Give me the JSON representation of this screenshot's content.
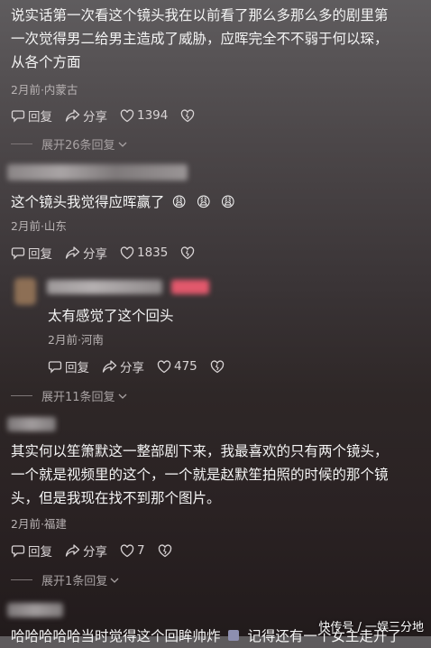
{
  "comments": [
    {
      "text_lines": [
        "说实话第一次看这个镜头我在以前看了那么多那么多的剧里第",
        "一次觉得男二给男主造成了威胁，应晖完全不不弱于何以琛，",
        "从各个方面"
      ],
      "meta": "2月前·内蒙古",
      "reply_label": "回复",
      "share_label": "分享",
      "likes": "1394",
      "expand_label": "展开26条回复"
    },
    {
      "text_lines": [
        "这个镜头我觉得应晖赢了"
      ],
      "emoji": [
        "😩",
        "😩",
        "😩"
      ],
      "meta": "2月前·山东",
      "reply_label": "回复",
      "share_label": "分享",
      "likes": "1835"
    },
    {
      "text_lines": [
        "太有感觉了这个回头"
      ],
      "meta": "2月前·河南",
      "reply_label": "回复",
      "share_label": "分享",
      "likes": "475",
      "expand_label": "展开11条回复"
    },
    {
      "text_lines": [
        "其实何以笙箫默这一整部剧下来，我最喜欢的只有两个镜头，",
        "一个就是视频里的这个，一个就是赵默笙拍照的时候的那个镜",
        "头，但是我现在找不到那个图片。"
      ],
      "meta": "2月前·福建",
      "reply_label": "回复",
      "share_label": "分享",
      "likes": "7",
      "expand_label": "展开1条回复"
    },
    {
      "text_lines": [
        "哈哈哈哈哈当时觉得这个回眸帅炸"
      ],
      "trailing": "记得还有一个女主走开了"
    }
  ],
  "watermark": "快传号 / 一娱三分地",
  "colors": {
    "like_heart": "#d9d4d5",
    "accent_badge": "#e2586c"
  }
}
